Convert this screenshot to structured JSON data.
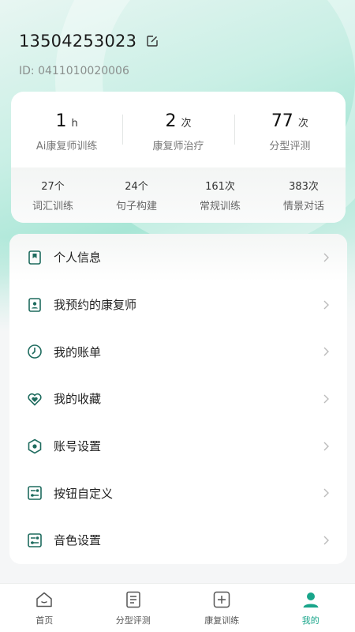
{
  "colors": {
    "accent": "#18a58a",
    "icon": "#1e6b5e"
  },
  "profile": {
    "phone": "13504253023",
    "id_label": "ID: 0411010020006"
  },
  "stats": [
    {
      "value": "1",
      "unit": "h",
      "label": "Ai康复师训练"
    },
    {
      "value": "2",
      "unit": "次",
      "label": "康复师治疗"
    },
    {
      "value": "77",
      "unit": "次",
      "label": "分型评测"
    }
  ],
  "sub_stats": [
    {
      "value": "27个",
      "label": "词汇训练"
    },
    {
      "value": "24个",
      "label": "句子构建"
    },
    {
      "value": "161次",
      "label": "常规训练"
    },
    {
      "value": "383次",
      "label": "情景对话"
    }
  ],
  "menu": [
    {
      "label": "个人信息",
      "icon": "bookmark-icon"
    },
    {
      "label": "我预约的康复师",
      "icon": "person-card-icon"
    },
    {
      "label": "我的账单",
      "icon": "clock-icon"
    },
    {
      "label": "我的收藏",
      "icon": "heart-icon"
    },
    {
      "label": "账号设置",
      "icon": "hexagon-icon"
    },
    {
      "label": "按钮自定义",
      "icon": "toggle-icon"
    },
    {
      "label": "音色设置",
      "icon": "toggle-icon"
    }
  ],
  "tabs": [
    {
      "label": "首页",
      "icon": "home-icon"
    },
    {
      "label": "分型评测",
      "icon": "document-icon"
    },
    {
      "label": "康复训练",
      "icon": "plus-square-icon"
    },
    {
      "label": "我的",
      "icon": "user-icon",
      "active": true
    }
  ]
}
